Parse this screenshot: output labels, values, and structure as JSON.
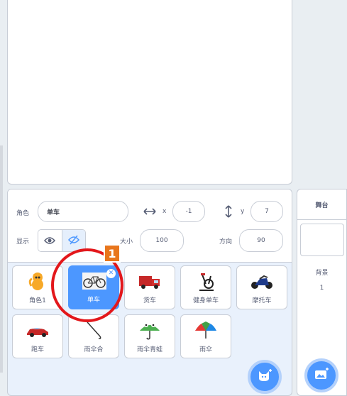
{
  "sprite_info": {
    "sprite_label": "角色",
    "sprite_name": "单车",
    "x_label": "x",
    "x_value": "-1",
    "y_label": "y",
    "y_value": "7",
    "show_label": "显示",
    "size_label": "大小",
    "size_value": "100",
    "direction_label": "方向",
    "direction_value": "90"
  },
  "sprites": [
    {
      "label": "角色1",
      "icon": "cat-icon"
    },
    {
      "label": "单车",
      "icon": "bicycle-icon",
      "selected": true
    },
    {
      "label": "货车",
      "icon": "truck-icon"
    },
    {
      "label": "健身单车",
      "icon": "exercise-bike-icon"
    },
    {
      "label": "摩托车",
      "icon": "motorcycle-icon"
    },
    {
      "label": "跑车",
      "icon": "sports-car-icon"
    },
    {
      "label": "雨伞合",
      "icon": "closed-umbrella-icon"
    },
    {
      "label": "雨伞青蛙",
      "icon": "frog-umbrella-icon"
    },
    {
      "label": "雨伞",
      "icon": "umbrella-icon"
    }
  ],
  "annotation": {
    "badge": "1",
    "color": "#e3171b",
    "badge_color": "#e8761d"
  },
  "stage_panel": {
    "title": "舞台",
    "backdrop_label": "背景",
    "backdrop_count": "1"
  },
  "colors": {
    "accent": "#4c97ff",
    "panel_bg": "#e9f1fc"
  }
}
